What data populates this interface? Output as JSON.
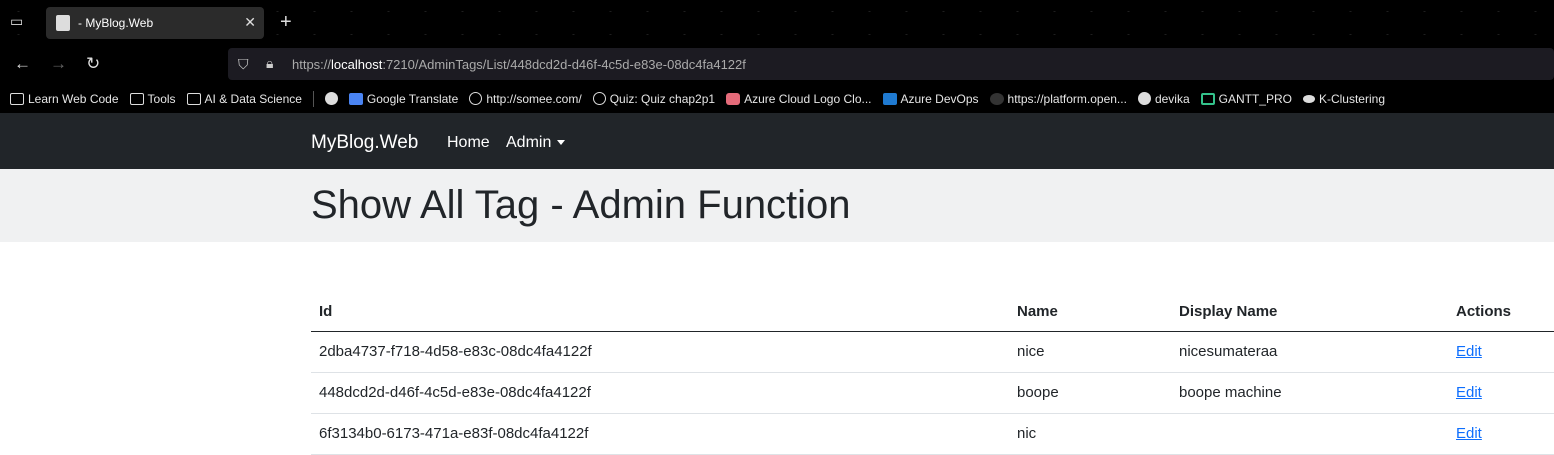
{
  "browser": {
    "tab_title": "- MyBlog.Web",
    "url_prefix": "https://",
    "url_host": "localhost",
    "url_path": ":7210/AdminTags/List/448dcd2d-d46f-4c5d-e83e-08dc4fa4122f",
    "bookmarks": [
      {
        "label": "Learn Web Code",
        "icon": "folder-icon"
      },
      {
        "label": "Tools",
        "icon": "folder-icon"
      },
      {
        "label": "AI & Data Science",
        "icon": "folder-icon"
      },
      {
        "label": "",
        "icon": "github-icon"
      },
      {
        "label": "Google Translate",
        "icon": "google-translate-icon"
      },
      {
        "label": "http://somee.com/",
        "icon": "globe-icon"
      },
      {
        "label": "Quiz: Quiz chap2p1",
        "icon": "globe-icon"
      },
      {
        "label": "Azure Cloud Logo  Clo...",
        "icon": "azure-logo-icon"
      },
      {
        "label": "Azure DevOps",
        "icon": "devops-icon"
      },
      {
        "label": "https://platform.open...",
        "icon": "openai-icon"
      },
      {
        "label": "devika",
        "icon": "github-icon"
      },
      {
        "label": "GANTT_PRO",
        "icon": "gantt-icon"
      },
      {
        "label": "K-Clustering",
        "icon": "medium-icon"
      }
    ]
  },
  "navbar": {
    "brand": "MyBlog.Web",
    "home": "Home",
    "admin": "Admin"
  },
  "page": {
    "title": "Show All Tag - Admin Function"
  },
  "table": {
    "headers": {
      "id": "Id",
      "name": "Name",
      "display_name": "Display Name",
      "actions": "Actions"
    },
    "rows": [
      {
        "id": "2dba4737-f718-4d58-e83c-08dc4fa4122f",
        "name": "nice",
        "display_name": "nicesumateraa",
        "action": "Edit"
      },
      {
        "id": "448dcd2d-d46f-4c5d-e83e-08dc4fa4122f",
        "name": "boope",
        "display_name": "boope machine",
        "action": "Edit"
      },
      {
        "id": "6f3134b0-6173-471a-e83f-08dc4fa4122f",
        "name": "nic",
        "display_name": "",
        "action": "Edit"
      }
    ]
  }
}
